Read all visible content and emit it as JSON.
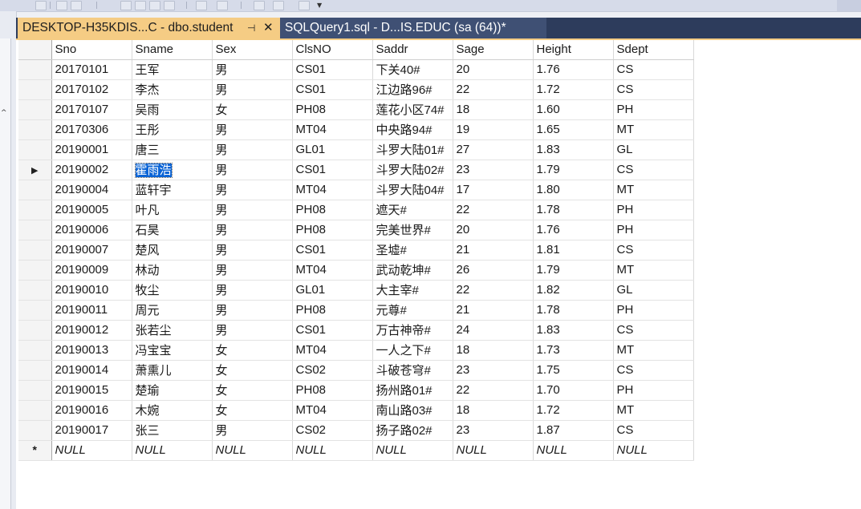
{
  "tabs": {
    "active": {
      "title": "DESKTOP-H35KDIS...C - dbo.student",
      "pin_glyph": "⊣",
      "close_glyph": "✕"
    },
    "second": {
      "title": "SQLQuery1.sql - D...IS.EDUC (sa (64))*"
    }
  },
  "grid": {
    "columns": [
      "Sno",
      "Sname",
      "Sex",
      "ClsNO",
      "Saddr",
      "Sage",
      "Height",
      "Sdept"
    ],
    "rows": [
      [
        "20170101",
        "王军",
        "男",
        "CS01",
        "下关40#",
        "20",
        "1.76",
        "CS"
      ],
      [
        "20170102",
        "李杰",
        "男",
        "CS01",
        "江边路96#",
        "22",
        "1.72",
        "CS"
      ],
      [
        "20170107",
        "吴雨",
        "女",
        "PH08",
        "莲花小区74#",
        "18",
        "1.60",
        "PH"
      ],
      [
        "20170306",
        "王彤",
        "男",
        "MT04",
        "中央路94#",
        "19",
        "1.65",
        "MT"
      ],
      [
        "20190001",
        "唐三",
        "男",
        "GL01",
        "斗罗大陆01#",
        "27",
        "1.83",
        "GL"
      ],
      [
        "20190002",
        "霍雨浩",
        "男",
        "CS01",
        "斗罗大陆02#",
        "23",
        "1.79",
        "CS"
      ],
      [
        "20190004",
        "蓝轩宇",
        "男",
        "MT04",
        "斗罗大陆04#",
        "17",
        "1.80",
        "MT"
      ],
      [
        "20190005",
        "叶凡",
        "男",
        "PH08",
        "遮天#",
        "22",
        "1.78",
        "PH"
      ],
      [
        "20190006",
        "石昊",
        "男",
        "PH08",
        "完美世界#",
        "20",
        "1.76",
        "PH"
      ],
      [
        "20190007",
        "楚风",
        "男",
        "CS01",
        "圣墟#",
        "21",
        "1.81",
        "CS"
      ],
      [
        "20190009",
        "林动",
        "男",
        "MT04",
        "武动乾坤#",
        "26",
        "1.79",
        "MT"
      ],
      [
        "20190010",
        "牧尘",
        "男",
        "GL01",
        "大主宰#",
        "22",
        "1.82",
        "GL"
      ],
      [
        "20190011",
        "周元",
        "男",
        "PH08",
        "元尊#",
        "21",
        "1.78",
        "PH"
      ],
      [
        "20190012",
        "张若尘",
        "男",
        "CS01",
        "万古神帝#",
        "24",
        "1.83",
        "CS"
      ],
      [
        "20190013",
        "冯宝宝",
        "女",
        "MT04",
        "一人之下#",
        "18",
        "1.73",
        "MT"
      ],
      [
        "20190014",
        "萧熏儿",
        "女",
        "CS02",
        "斗破苍穹#",
        "23",
        "1.75",
        "CS"
      ],
      [
        "20190015",
        "楚瑜",
        "女",
        "PH08",
        "扬州路01#",
        "22",
        "1.70",
        "PH"
      ],
      [
        "20190016",
        "木婉",
        "女",
        "MT04",
        "南山路03#",
        "18",
        "1.72",
        "MT"
      ],
      [
        "20190017",
        "张三",
        "男",
        "CS02",
        "扬子路02#",
        "23",
        "1.87",
        "CS"
      ]
    ],
    "current_row_index": 5,
    "selected_cell": {
      "row": 5,
      "col": 1
    },
    "current_row_marker": "▶",
    "new_row_marker": "*",
    "null_text": "NULL"
  },
  "colors": {
    "tab_active": "#f5cc84",
    "tab_inactive": "#3f5074",
    "tab_strip": "#2d3c5c",
    "selection": "#0a64d6"
  }
}
